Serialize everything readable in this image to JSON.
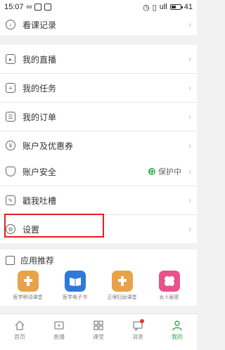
{
  "statusbar": {
    "time": "15:07",
    "battery": "41",
    "signal_label": "ull"
  },
  "menu": {
    "history": "看课记录",
    "live": "我的直播",
    "tasks": "我的任务",
    "orders": "我的订单",
    "account": "账户及优惠券",
    "security": "账户安全",
    "security_status": "保护中",
    "feedback": "戳我吐槽",
    "settings": "设置",
    "apps_title": "应用推荐"
  },
  "apps": [
    {
      "name": "医学移动课堂",
      "color": "#e9a24a"
    },
    {
      "name": "医学电子书",
      "color": "#2f79d8"
    },
    {
      "name": "正保妇幼课堂",
      "color": "#e9a24a"
    },
    {
      "name": "女人秘密",
      "color": "#e9528a"
    }
  ],
  "tabs": [
    {
      "label": "首页",
      "icon": "home-icon"
    },
    {
      "label": "直播",
      "icon": "tv-icon"
    },
    {
      "label": "课堂",
      "icon": "grid-icon"
    },
    {
      "label": "消息",
      "icon": "message-icon"
    },
    {
      "label": "我的",
      "icon": "person-icon"
    }
  ],
  "colors": {
    "accent": "#2fa84f",
    "highlight": "#e32020",
    "badge": "#e53935"
  }
}
